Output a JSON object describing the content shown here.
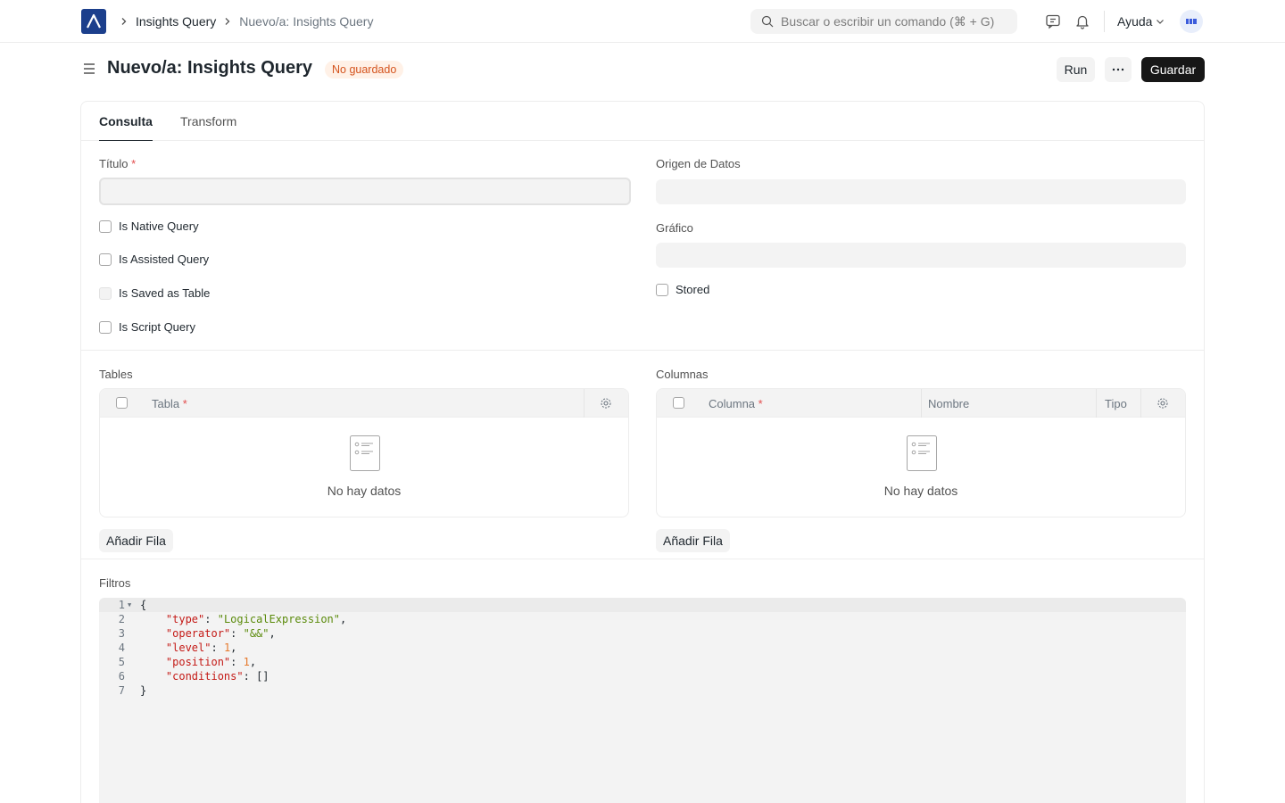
{
  "navbar": {
    "breadcrumbs": [
      "Insights Query",
      "Nuevo/a: Insights Query"
    ],
    "search_placeholder": "Buscar o escribir un comando (⌘ + G)",
    "help_label": "Ayuda"
  },
  "page": {
    "title": "Nuevo/a: Insights Query",
    "status": "No guardado",
    "run_label": "Run",
    "more_label": "···",
    "save_label": "Guardar"
  },
  "tabs": [
    {
      "label": "Consulta",
      "active": true
    },
    {
      "label": "Transform",
      "active": false
    }
  ],
  "form": {
    "title_label": "Título",
    "required_mark": "*",
    "data_source_label": "Origen de Datos",
    "chart_label": "Gráfico",
    "checkboxes_left": [
      {
        "label": "Is Native Query",
        "checked": false,
        "disabled": false
      },
      {
        "label": "Is Assisted Query",
        "checked": false,
        "disabled": false
      },
      {
        "label": "Is Saved as Table",
        "checked": false,
        "disabled": true
      },
      {
        "label": "Is Script Query",
        "checked": false,
        "disabled": false
      }
    ],
    "stored_label": "Stored"
  },
  "tables_grid": {
    "label": "Tables",
    "columns": [
      "Tabla"
    ],
    "empty_text": "No hay datos",
    "add_row_label": "Añadir Fila"
  },
  "columns_grid": {
    "label": "Columnas",
    "columns": [
      "Columna",
      "Nombre",
      "Tipo"
    ],
    "empty_text": "No hay datos",
    "add_row_label": "Añadir Fila"
  },
  "filters": {
    "label": "Filtros",
    "line_numbers": [
      "1",
      "2",
      "3",
      "4",
      "5",
      "6",
      "7"
    ],
    "code": {
      "open": "{",
      "type_key": "\"type\"",
      "type_val": "\"LogicalExpression\"",
      "operator_key": "\"operator\"",
      "operator_val": "\"&&\"",
      "level_key": "\"level\"",
      "level_val": "1",
      "position_key": "\"position\"",
      "position_val": "1",
      "conditions_key": "\"conditions\"",
      "conditions_val": "[]",
      "close": "}"
    }
  },
  "colors": {
    "brand": "#1c3f8c",
    "primary_button": "#171717",
    "status_bg": "#fff1e7",
    "status_text": "#d4531d"
  }
}
